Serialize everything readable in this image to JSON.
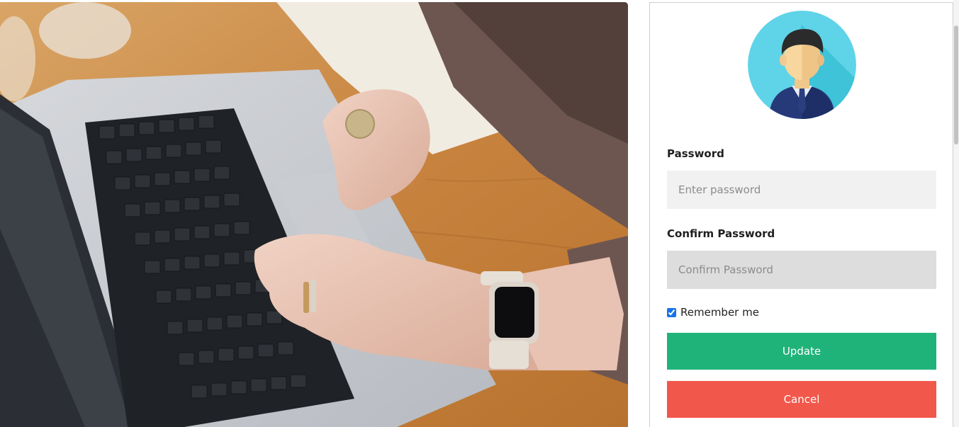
{
  "hero": {
    "alt": "Hands typing on a laptop keyboard"
  },
  "profile": {
    "avatar_icon": "user-avatar-icon"
  },
  "form": {
    "password": {
      "label": "Password",
      "placeholder": "Enter password",
      "value": ""
    },
    "confirm_password": {
      "label": "Confirm Password",
      "placeholder": "Confirm Password",
      "value": ""
    },
    "remember": {
      "label": "Remember me",
      "checked": true
    },
    "update_label": "Update",
    "cancel_label": "Cancel"
  },
  "colors": {
    "update": "#1fb37a",
    "cancel": "#f2574b",
    "avatar_bg": "#5fd3e8"
  }
}
